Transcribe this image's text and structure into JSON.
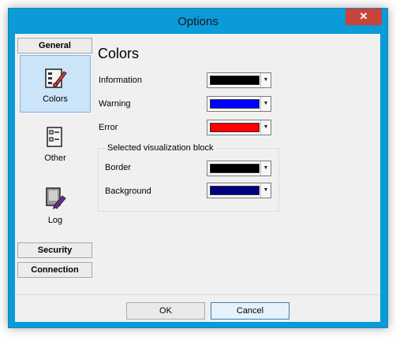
{
  "window": {
    "title": "Options",
    "close_glyph": "✕"
  },
  "sidebar": {
    "general_label": "General",
    "items": [
      {
        "label": "Colors",
        "icon": "colors-palette-icon",
        "selected": true
      },
      {
        "label": "Other",
        "icon": "list-icon",
        "selected": false
      },
      {
        "label": "Log",
        "icon": "log-pen-icon",
        "selected": false
      }
    ],
    "security_label": "Security",
    "connection_label": "Connection"
  },
  "main": {
    "heading": "Colors",
    "rows": [
      {
        "label": "Information",
        "color": "#000000"
      },
      {
        "label": "Warning",
        "color": "#0000ff"
      },
      {
        "label": "Error",
        "color": "#ff0000"
      }
    ],
    "group": {
      "title": "Selected visualization block",
      "rows": [
        {
          "label": "Border",
          "color": "#000000"
        },
        {
          "label": "Background",
          "color": "#000080"
        }
      ]
    }
  },
  "buttons": {
    "ok": "OK",
    "cancel": "Cancel"
  },
  "colors": {
    "accent": "#0a9bd8",
    "selected_bg": "#cce4f7",
    "close": "#c7443a"
  }
}
